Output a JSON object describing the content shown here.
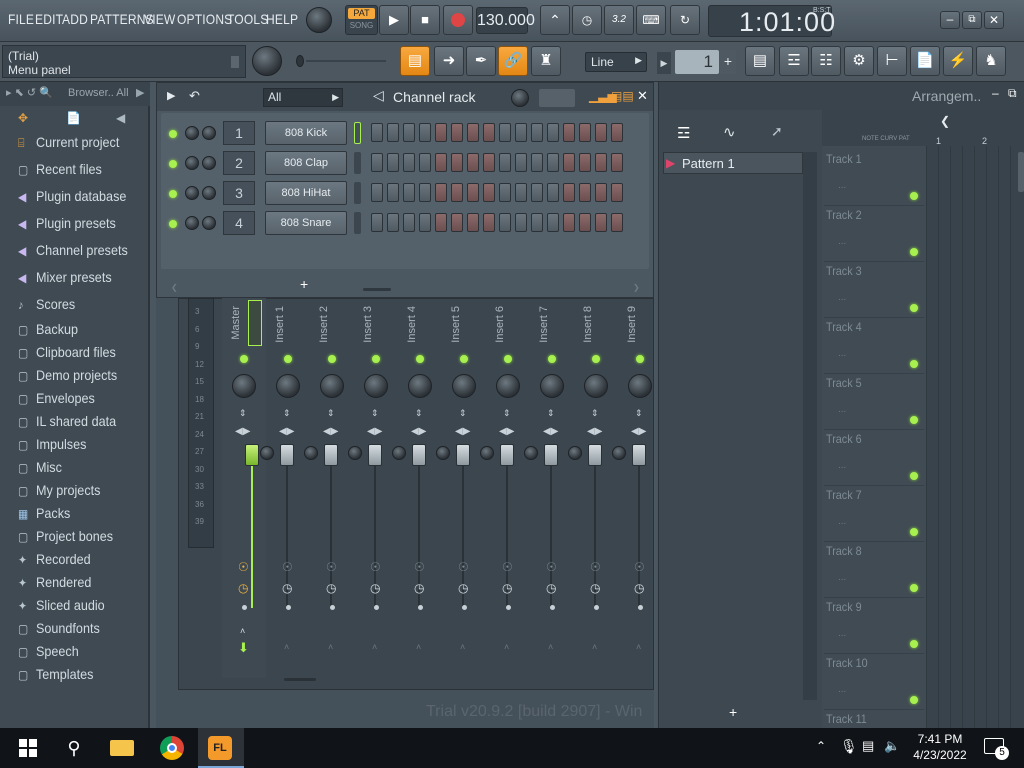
{
  "menu": {
    "items": [
      "FILE",
      "EDIT",
      "ADD",
      "PATTERNS",
      "VIEW",
      "OPTIONS",
      "TOOLS",
      "HELP"
    ]
  },
  "transport": {
    "pat_label": "PAT",
    "song_label": "SONG",
    "tempo": "130.000",
    "time": "1:01:00",
    "time_format": "B:S:T"
  },
  "hint_panel": {
    "line1": "(Trial)",
    "line2": "Menu panel"
  },
  "toolbar": {
    "snap_value": "Line",
    "pattern_number": "1"
  },
  "browser": {
    "header": "Browser.. All",
    "items": [
      {
        "label": "Current project",
        "icon": "project-icon"
      },
      {
        "label": "Recent files",
        "icon": "folder-icon"
      },
      {
        "label": "Plugin database",
        "icon": "plug-icon"
      },
      {
        "label": "Plugin presets",
        "icon": "plug-icon"
      },
      {
        "label": "Channel presets",
        "icon": "plug-icon"
      },
      {
        "label": "Mixer presets",
        "icon": "plug-icon"
      },
      {
        "label": "Scores",
        "icon": "note-icon"
      },
      {
        "label": "Backup",
        "icon": "folder-icon"
      },
      {
        "label": "Clipboard files",
        "icon": "folder-icon"
      },
      {
        "label": "Demo projects",
        "icon": "folder-icon"
      },
      {
        "label": "Envelopes",
        "icon": "folder-icon"
      },
      {
        "label": "IL shared data",
        "icon": "folder-icon"
      },
      {
        "label": "Impulses",
        "icon": "folder-icon"
      },
      {
        "label": "Misc",
        "icon": "folder-icon"
      },
      {
        "label": "My projects",
        "icon": "folder-icon"
      },
      {
        "label": "Packs",
        "icon": "packs-icon"
      },
      {
        "label": "Project bones",
        "icon": "folder-icon"
      },
      {
        "label": "Recorded",
        "icon": "wave-icon"
      },
      {
        "label": "Rendered",
        "icon": "wave-icon"
      },
      {
        "label": "Sliced audio",
        "icon": "wave-icon"
      },
      {
        "label": "Soundfonts",
        "icon": "folder-icon"
      },
      {
        "label": "Speech",
        "icon": "folder-icon"
      },
      {
        "label": "Templates",
        "icon": "folder-icon"
      }
    ]
  },
  "channel_rack": {
    "title": "Channel rack",
    "filter": "All",
    "channels": [
      {
        "num": "1",
        "name": "808 Kick"
      },
      {
        "num": "2",
        "name": "808 Clap"
      },
      {
        "num": "3",
        "name": "808 HiHat"
      },
      {
        "num": "4",
        "name": "808 Snare"
      }
    ],
    "add_label": "+"
  },
  "mixer": {
    "master_label": "Master",
    "inserts": [
      "Insert 1",
      "Insert 2",
      "Insert 3",
      "Insert 4",
      "Insert 5",
      "Insert 6",
      "Insert 7",
      "Insert 8",
      "Insert 9"
    ],
    "meter_scale": [
      "3",
      "6",
      "9",
      "12",
      "15",
      "18",
      "21",
      "24",
      "27",
      "30",
      "33",
      "36",
      "39"
    ]
  },
  "pattern_picker": {
    "patterns": [
      "Pattern 1"
    ],
    "add_label": "+"
  },
  "playlist": {
    "title": "Arrangem..",
    "ruler": [
      "1",
      "2"
    ],
    "tabs_hint": "NOTE CURV PAT",
    "tracks": [
      "Track 1",
      "Track 2",
      "Track 3",
      "Track 4",
      "Track 5",
      "Track 6",
      "Track 7",
      "Track 8",
      "Track 9",
      "Track 10",
      "Track 11"
    ]
  },
  "watermark": "Trial v20.9.2 [build 2907] - Win",
  "taskbar": {
    "time": "7:41 PM",
    "date": "4/23/2022",
    "notification_count": "5"
  }
}
